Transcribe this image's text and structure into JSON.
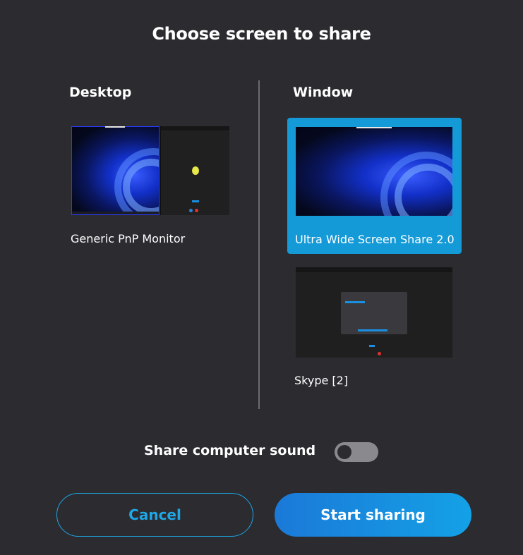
{
  "dialog": {
    "title": "Choose screen to share"
  },
  "desktop": {
    "heading": "Desktop",
    "sources": [
      {
        "label": "Generic PnP Monitor"
      }
    ]
  },
  "window": {
    "heading": "Window",
    "sources": [
      {
        "label": "Ultra Wide Screen Share 2.0",
        "selected": true
      },
      {
        "label": "Skype [2]",
        "selected": false
      }
    ]
  },
  "sound": {
    "label": "Share computer sound",
    "enabled": false
  },
  "buttons": {
    "cancel": "Cancel",
    "start": "Start sharing"
  },
  "colors": {
    "background": "#2b2b30",
    "accent": "#159ad8",
    "cancel_border": "#1fa7e6"
  }
}
